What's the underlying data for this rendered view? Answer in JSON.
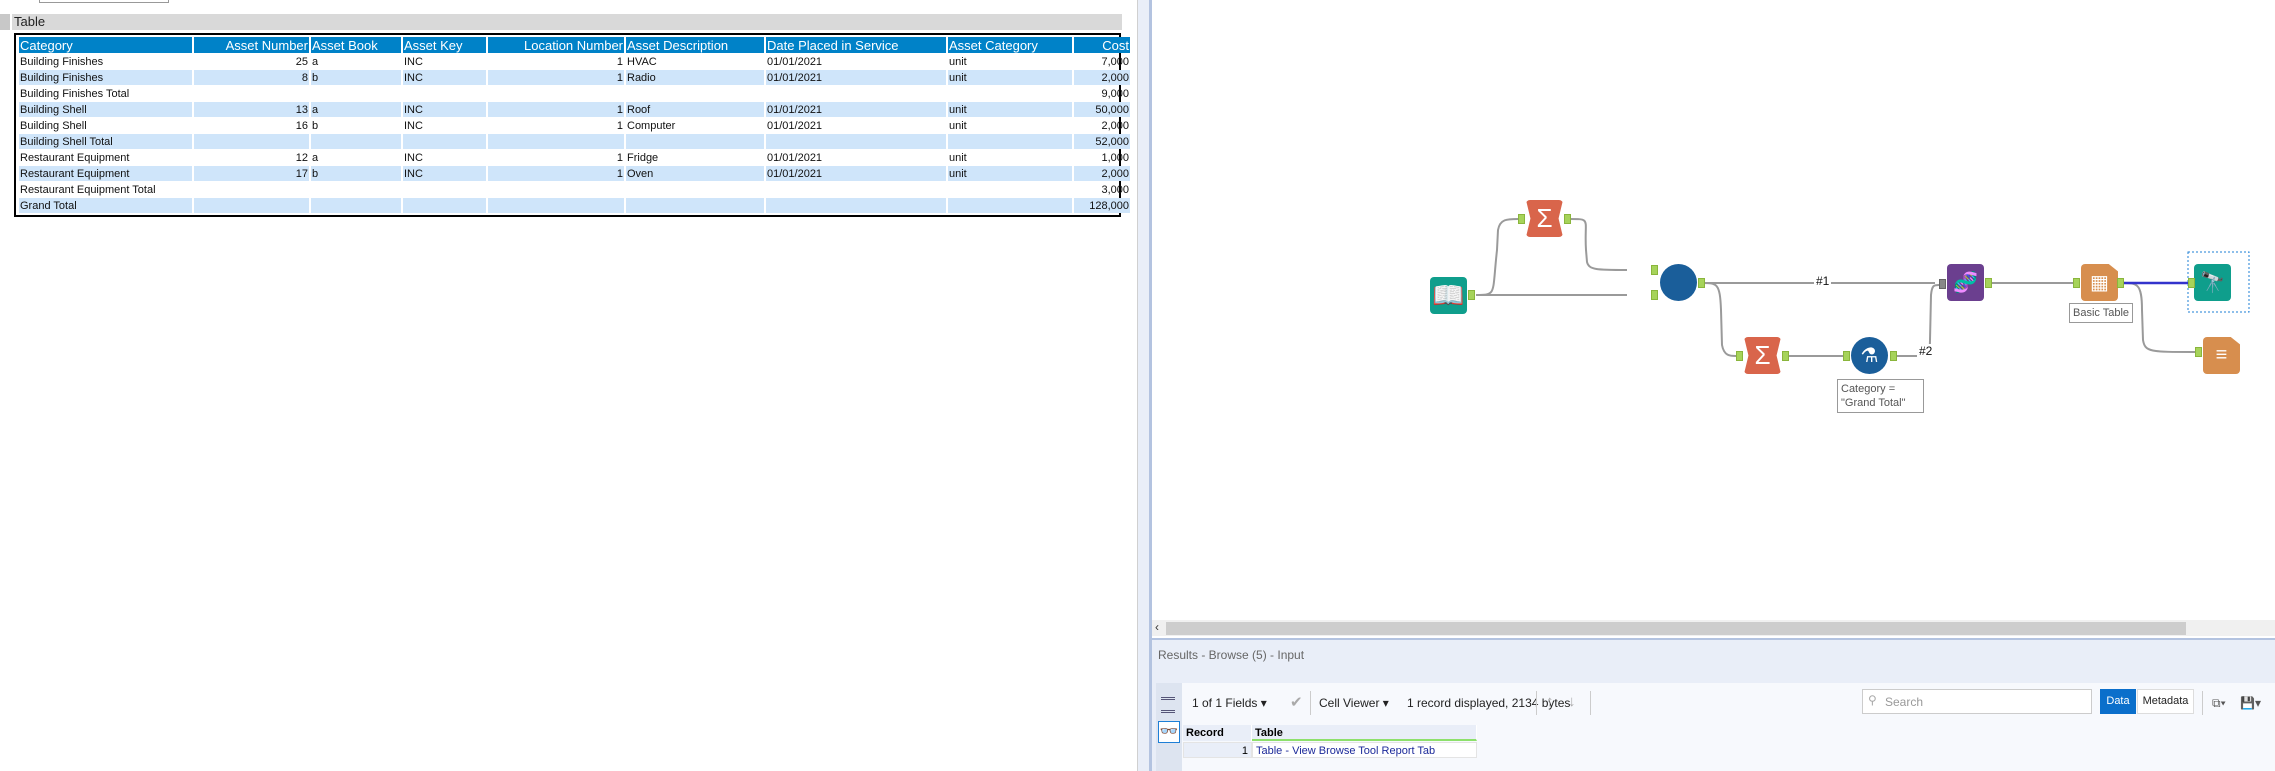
{
  "report": {
    "section_title": "Table",
    "columns": [
      "Category",
      "Asset Number",
      "Asset Book",
      "Asset Key",
      "Location Number",
      "Asset Description",
      "Date Placed in Service",
      "Asset Category",
      "Cost"
    ],
    "numeric_columns": [
      1,
      4,
      8
    ],
    "rows": [
      [
        "Building Finishes",
        "25",
        "a",
        "INC",
        "1",
        "HVAC",
        "01/01/2021",
        "unit",
        "7,000"
      ],
      [
        "Building Finishes",
        "8",
        "b",
        "INC",
        "1",
        "Radio",
        "01/01/2021",
        "unit",
        "2,000"
      ],
      [
        "Building Finishes Total",
        "",
        "",
        "",
        "",
        "",
        "",
        "",
        "9,000"
      ],
      [
        "Building Shell",
        "13",
        "a",
        "INC",
        "1",
        "Roof",
        "01/01/2021",
        "unit",
        "50,000"
      ],
      [
        "Building Shell",
        "16",
        "b",
        "INC",
        "1",
        "Computer",
        "01/01/2021",
        "unit",
        "2,000"
      ],
      [
        "Building Shell Total",
        "",
        "",
        "",
        "",
        "",
        "",
        "",
        "52,000"
      ],
      [
        "Restaurant Equipment",
        "12",
        "a",
        "INC",
        "1",
        "Fridge",
        "01/01/2021",
        "unit",
        "1,000"
      ],
      [
        "Restaurant Equipment",
        "17",
        "b",
        "INC",
        "1",
        "Oven",
        "01/01/2021",
        "unit",
        "2,000"
      ],
      [
        "Restaurant Equipment Total",
        "",
        "",
        "",
        "",
        "",
        "",
        "",
        "3,000"
      ],
      [
        "Grand Total",
        "",
        "",
        "",
        "",
        "",
        "",
        "",
        "128,000"
      ]
    ]
  },
  "workflow": {
    "connection_labels": [
      "#1",
      "#2"
    ],
    "annotations": {
      "table": "Basic Table",
      "formula": "Category =\n\"Grand Total\""
    },
    "colors": {
      "summarize": "#d9654b",
      "join": "#1a5e9a",
      "input": "#0f9e8c",
      "union": "#6b3f8f",
      "table": "#d78e4e",
      "browse": "#0f9e8c",
      "formula": "#1a5e9a",
      "anchor": "#a6d35a",
      "wire": "#9a9a9a",
      "selected_wire": "#3333cc"
    }
  },
  "results": {
    "title": "Results - Browse (5) - Input",
    "fields": "1 of 1 Fields",
    "viewer": "Cell Viewer",
    "status": "1 record displayed, 2134 bytes",
    "search_placeholder": "Search",
    "data_tab": "Data",
    "metadata_tab": "Metadata",
    "grid": {
      "headers": [
        "Record",
        "Table"
      ],
      "rows": [
        [
          "1",
          "Table - View Browse Tool Report Tab"
        ]
      ]
    }
  }
}
